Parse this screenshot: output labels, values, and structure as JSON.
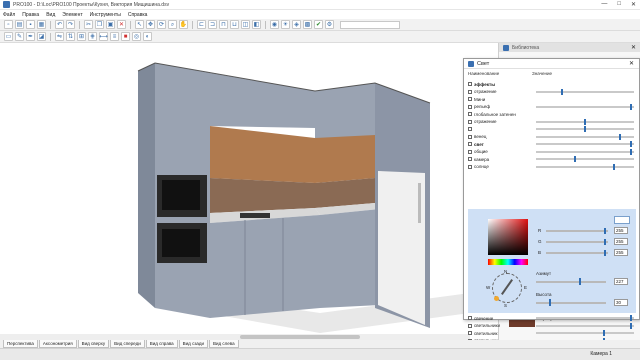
{
  "window": {
    "title": "PRO100 - D:\\Loc\\PRO100 Проекты\\Кухня, Виктория Мищишина.dsv",
    "controls": [
      "—",
      "□",
      "✕"
    ]
  },
  "menu": [
    "Файл",
    "Правка",
    "Вид",
    "Элемент",
    "Инструменты",
    "Справка"
  ],
  "library": {
    "title": "Библиотека",
    "swatch_label": "Прозрачный"
  },
  "dialog": {
    "title": "Свет",
    "col_name": "Наименование",
    "col_value": "Значение",
    "rows": [
      {
        "label": "эффекты",
        "knob": null,
        "hdr": true
      },
      {
        "label": "отражение",
        "knob": 0.26
      },
      {
        "label": "Мини",
        "knob": null
      },
      {
        "label": "рельеф",
        "knob": 0.98
      },
      {
        "label": "глобальное затенен",
        "knob": null
      },
      {
        "label": "отражение",
        "knob": 0.5
      },
      {
        "label": "",
        "knob": 0.5
      },
      {
        "label": "венец",
        "knob": 0.86
      },
      {
        "label": "свет",
        "knob": 0.98,
        "hdr": true
      },
      {
        "label": "общие",
        "knob": 0.98
      },
      {
        "label": "камера",
        "knob": 0.4
      },
      {
        "label": "солнце",
        "knob": 0.8
      }
    ],
    "rgb": [
      {
        "label": "R",
        "value": "255",
        "pos": 0.96
      },
      {
        "label": "G",
        "value": "255",
        "pos": 0.96
      },
      {
        "label": "B",
        "value": "255",
        "pos": 0.96
      }
    ],
    "azimuth_label": "Азимут",
    "azimuth_value": "227",
    "azimuth_pos": 0.62,
    "height_label": "Высота",
    "height_value": "30",
    "height_pos": 0.18,
    "compass_n": "N",
    "compass_e": "E",
    "compass_s": "S",
    "compass_w": "W",
    "bottom_rows": [
      {
        "label": "свечение",
        "knob": 0.98
      },
      {
        "label": "светильники",
        "knob": 0.98
      },
      {
        "label": "светильник",
        "knob": 0.7
      },
      {
        "label": "светильник",
        "knob": 0.7
      }
    ]
  },
  "tabs": [
    "Перспектива",
    "Аксонометрия",
    "Вид сверху",
    "Вид спереди",
    "Вид справа",
    "Вид сзади",
    "Вид слева"
  ],
  "status": {
    "camera": "Камера 1"
  }
}
